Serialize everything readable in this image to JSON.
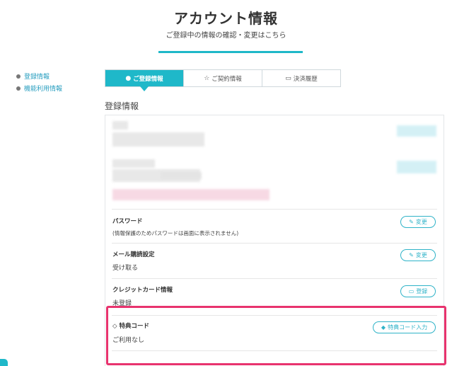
{
  "page": {
    "title": "アカウント情報",
    "subtitle": "ご登録中の情報の確認・変更はこちら"
  },
  "side_nav": {
    "items": [
      {
        "label": "登録情報"
      },
      {
        "label": "機能利用情報"
      }
    ]
  },
  "tabs": [
    {
      "label": "ご登録情報",
      "icon": "user-icon",
      "glyph": "👤",
      "active": true
    },
    {
      "label": "ご契約情報",
      "icon": "star-icon",
      "glyph": "☆",
      "active": false
    },
    {
      "label": "決済履歴",
      "icon": "card-icon",
      "glyph": "▭",
      "active": false
    }
  ],
  "section": {
    "heading": "登録情報"
  },
  "rows": {
    "password": {
      "label": "パスワード",
      "note": "(情報保護のためパスワードは画面に表示されません)",
      "button": "変更",
      "button_icon": "edit-icon"
    },
    "mail": {
      "label": "メール購読設定",
      "value": "受け取る",
      "button": "変更",
      "button_icon": "edit-icon"
    },
    "credit": {
      "label": "クレジットカード情報",
      "value": "未登録",
      "button": "登録",
      "button_icon": "card-icon"
    },
    "coupon": {
      "label": "特典コード",
      "label_icon": "gem-icon",
      "value": "ご利用なし",
      "button": "特典コード入力",
      "button_icon": "tag-icon"
    }
  },
  "colors": {
    "accent": "#1fb8c9",
    "highlight": "#e8336e",
    "link": "#2a9fc0"
  }
}
